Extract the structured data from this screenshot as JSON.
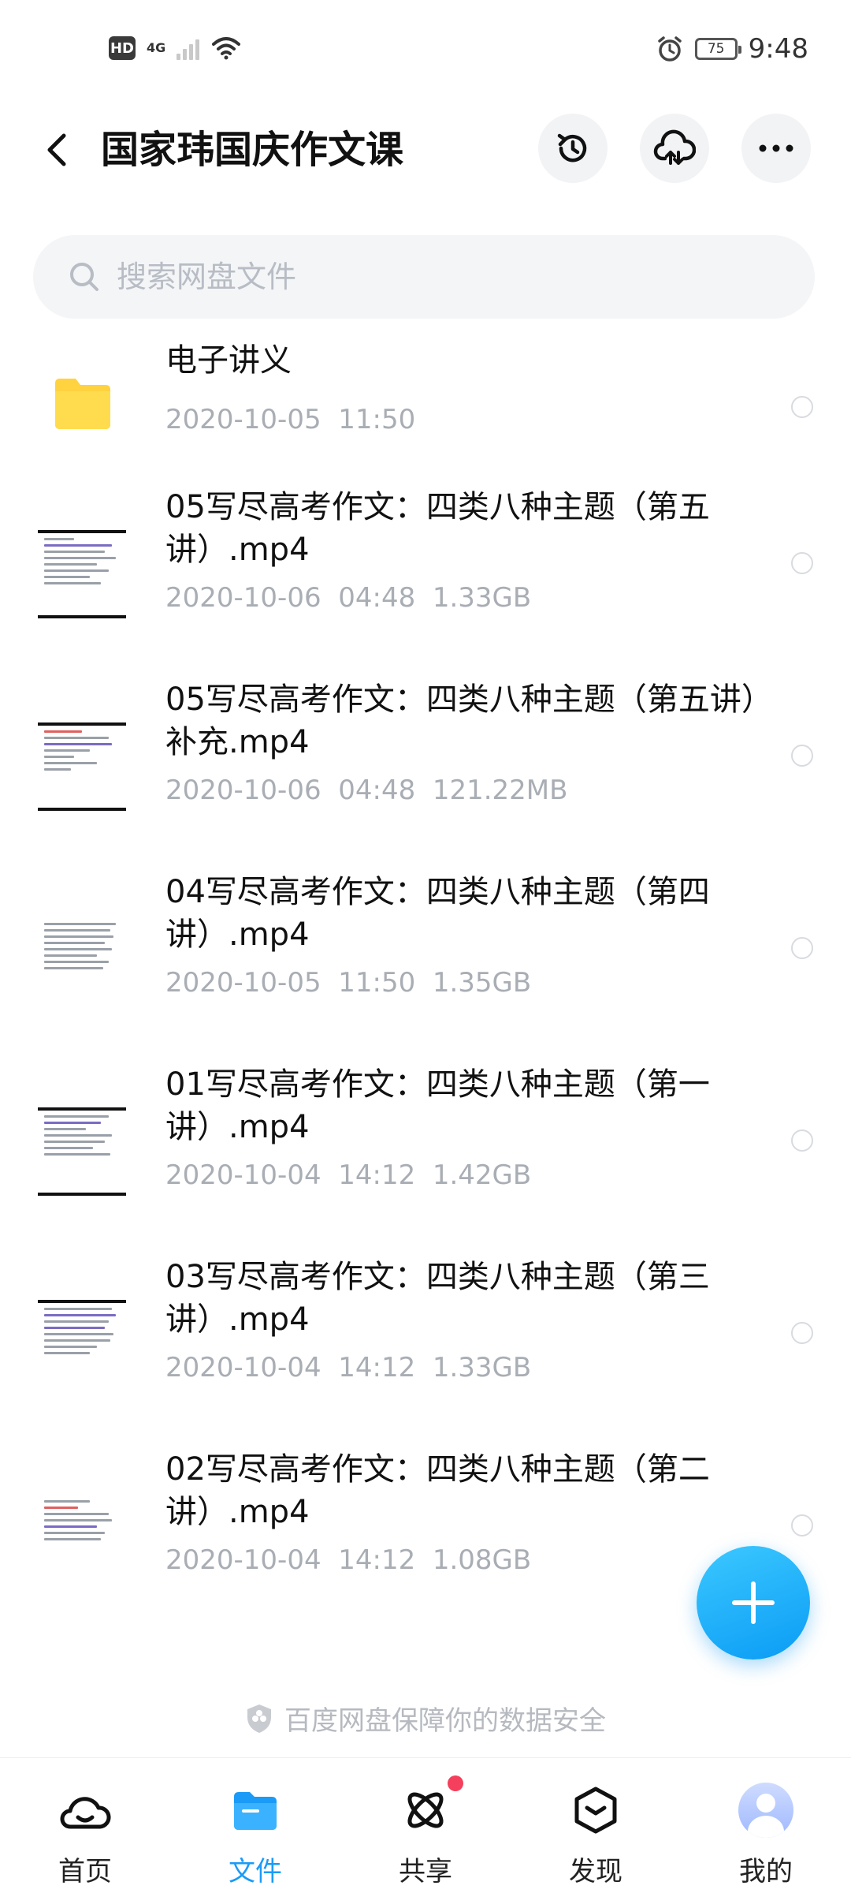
{
  "status_bar": {
    "hd": "HD",
    "network": "4G",
    "battery": "75",
    "time": "9:48"
  },
  "header": {
    "title": "国家玮国庆作文课",
    "icons": [
      "back-icon",
      "history-icon",
      "cloud-upload-icon",
      "more-icon"
    ]
  },
  "search": {
    "placeholder": "搜索网盘文件"
  },
  "files": [
    {
      "name": "电子讲义",
      "date": "2020-10-05",
      "time": "11:50",
      "size": ""
    },
    {
      "name": "05写尽高考作文：四类八种主题（第五讲）.mp4",
      "date": "2020-10-06",
      "time": "04:48",
      "size": "1.33GB"
    },
    {
      "name": "05写尽高考作文：四类八种主题（第五讲）补充.mp4",
      "date": "2020-10-06",
      "time": "04:48",
      "size": "121.22MB"
    },
    {
      "name": "04写尽高考作文：四类八种主题（第四讲）.mp4",
      "date": "2020-10-05",
      "time": "11:50",
      "size": "1.35GB"
    },
    {
      "name": "01写尽高考作文：四类八种主题（第一讲）.mp4",
      "date": "2020-10-04",
      "time": "14:12",
      "size": "1.42GB"
    },
    {
      "name": "03写尽高考作文：四类八种主题（第三讲）.mp4",
      "date": "2020-10-04",
      "time": "14:12",
      "size": "1.33GB"
    },
    {
      "name": "02写尽高考作文：四类八种主题（第二讲）.mp4",
      "date": "2020-10-04",
      "time": "14:12",
      "size": "1.08GB"
    }
  ],
  "footer": {
    "safety_text": "百度网盘保障你的数据安全"
  },
  "nav": {
    "items": [
      {
        "label": "首页",
        "icon": "home-icon"
      },
      {
        "label": "文件",
        "icon": "folder-icon",
        "active": true
      },
      {
        "label": "共享",
        "icon": "share-icon",
        "badge": true
      },
      {
        "label": "发现",
        "icon": "discover-icon"
      },
      {
        "label": "我的",
        "icon": "avatar"
      }
    ]
  },
  "colors": {
    "accent": "#1a9bf7",
    "folder": "#ffd23f",
    "muted_text": "#a9adb4",
    "badge": "#f4405c"
  }
}
